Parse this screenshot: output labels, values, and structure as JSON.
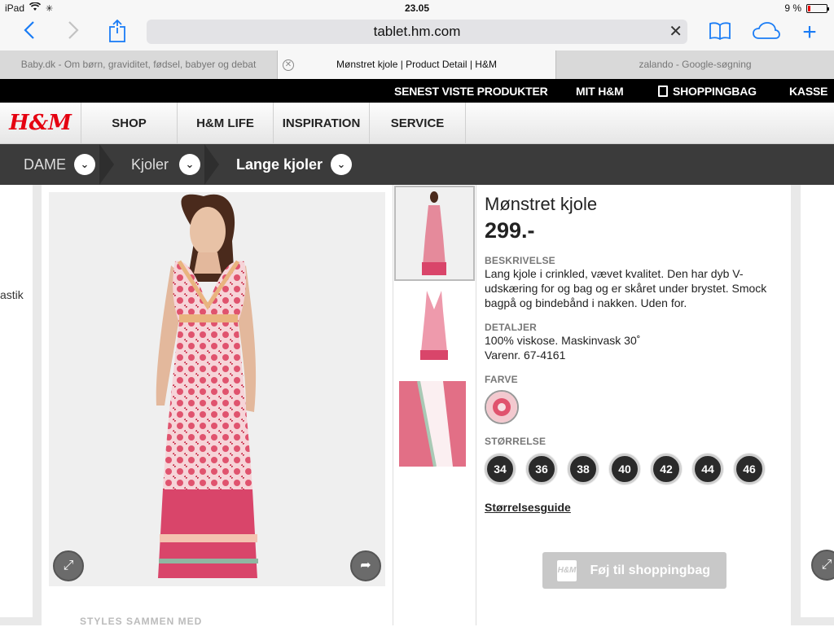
{
  "status_bar": {
    "device": "iPad",
    "time": "23.05",
    "battery": "9 %"
  },
  "browser": {
    "url": "tablet.hm.com",
    "tabs": [
      {
        "title": "Baby.dk - Om børn, graviditet, fødsel, babyer og debat"
      },
      {
        "title": "Mønstret kjole | Product Detail | H&M"
      },
      {
        "title": "zalando - Google-søgning"
      }
    ]
  },
  "topbar": {
    "recent": "SENEST VISTE PRODUKTER",
    "my_hm": "MIT H&M",
    "bag": "SHOPPINGBAG",
    "checkout": "KASSE"
  },
  "nav": {
    "logo": "H&M",
    "items": [
      "SHOP",
      "H&M LIFE",
      "INSPIRATION",
      "SERVICE"
    ]
  },
  "breadcrumb": [
    "DAME",
    "Kjoler",
    "Lange kjoler"
  ],
  "left_fragment": "astik",
  "product": {
    "title": "Mønstret kjole",
    "price": "299.-",
    "description_label": "BESKRIVELSE",
    "description": "Lang kjole i crinkled, vævet kvalitet. Den har dyb V-udskæring for og bag og er skåret under brystet. Smock bagpå og bindebånd i nakken. Uden for.",
    "details_label": "DETALJER",
    "details_line1": "100% viskose. Maskinvask 30˚",
    "details_line2": "Varenr. 67-4161",
    "color_label": "FARVE",
    "size_label": "STØRRELSE",
    "sizes": [
      "34",
      "36",
      "38",
      "40",
      "42",
      "44",
      "46"
    ],
    "size_guide": "Størrelsesguide",
    "add_to_bag": "Føj til shoppingbag",
    "colors": {
      "dress_pink": "#e0536e",
      "dress_light": "#f3c9cf"
    }
  },
  "bottom_fragment": "STYLES SAMMEN MED"
}
